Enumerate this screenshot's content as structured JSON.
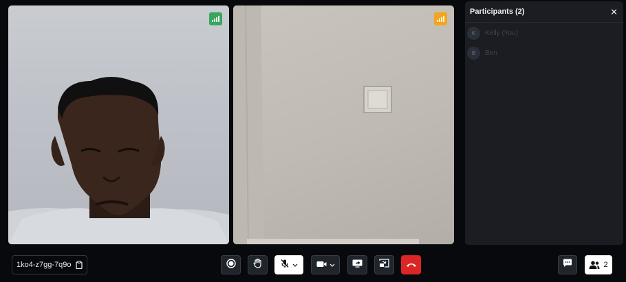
{
  "video_tiles": [
    {
      "network_signal_color": "#3aa55d"
    },
    {
      "network_signal_color": "#f4a51c"
    }
  ],
  "participants_panel": {
    "title": "Participants (2)",
    "close_icon": "close-icon",
    "participants": [
      {
        "initial": "K",
        "name": "Kelly (You)"
      },
      {
        "initial": "B",
        "name": "Ben"
      }
    ]
  },
  "toolbar": {
    "meeting_id": "1ko4-z7gg-7q9o",
    "participants_count": "2",
    "icons": [
      "record-icon",
      "raise-hand-icon",
      "mic-muted-icon",
      "camera-icon",
      "screen-share-icon",
      "picture-in-picture-icon",
      "end-call-icon",
      "chat-icon",
      "participants-icon"
    ],
    "end_call_color": "#dc2626"
  }
}
